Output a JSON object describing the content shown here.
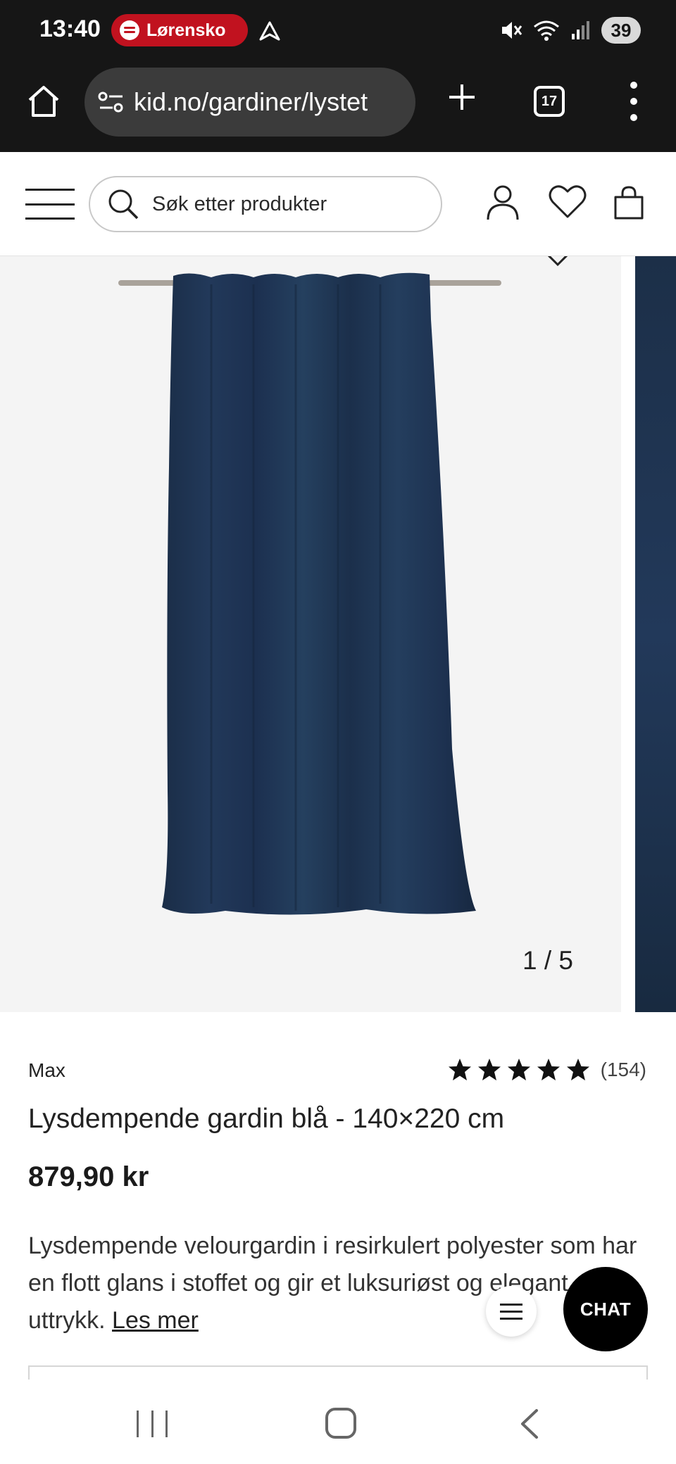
{
  "status_bar": {
    "time": "13:40",
    "spotify_label": "Lørensko",
    "battery": "39"
  },
  "browser": {
    "url": "kid.no/gardiner/lystet",
    "tab_count": "17"
  },
  "header": {
    "search_placeholder": "Søk etter produkter"
  },
  "gallery": {
    "counter": "1 / 5",
    "current_index": 1,
    "total": 5
  },
  "product": {
    "brand": "Max",
    "rating_stars": 5,
    "review_count": "(154)",
    "title": "Lysdempende gardin blå - 140×220 cm",
    "price": "879,90 kr",
    "description": "Lysdempende velourgardin i resirkulert polyester som har en flott glans i stoffet og gir et luksuriøst og elegant uttrykk.",
    "read_more": "Les mer"
  },
  "chat": {
    "label": "CHAT"
  },
  "colors": {
    "browser_bg": "#161616",
    "spotify_pill": "#c1121f",
    "curtain_navy": "#1e3350",
    "chat_bg": "#000000"
  }
}
